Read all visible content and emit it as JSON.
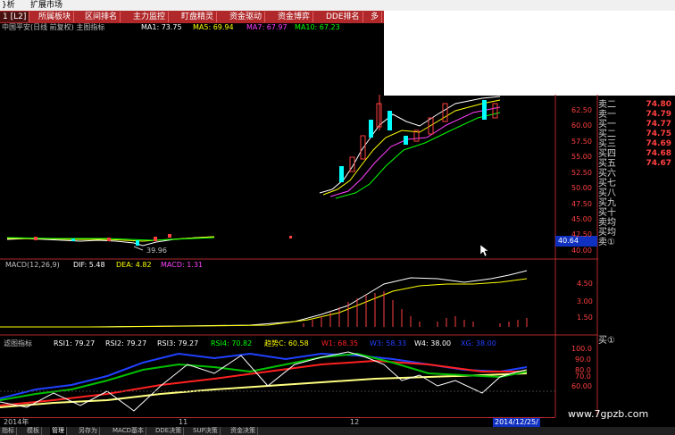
{
  "topbar": {
    "item1": "}析",
    "item2": "扩展市场"
  },
  "tabs": [
    "1 [L2]",
    "所属板块",
    "区间排名",
    "主力监控",
    "盯盘精灵",
    "资金驱动",
    "资金博弈",
    "DDE排名",
    "多"
  ],
  "info": {
    "title": "中国平安(日线 前复权) 主图指标",
    "ma1": "MA1: 73.75",
    "ma5": "MA5: 69.94",
    "ma7": "MA7: 67.97",
    "ma10": "MA10: 67.23"
  },
  "price_axis": [
    "62.50",
    "60.00",
    "57.50",
    "55.00",
    "52.50",
    "50.00",
    "47.50",
    "45.00",
    "42.50",
    "40.00"
  ],
  "price_marker": "40.64",
  "low_label": "39.96",
  "quotes": [
    {
      "label": "卖二",
      "value": "74.80"
    },
    {
      "label": "卖一",
      "value": "74.79"
    },
    {
      "label": "买一",
      "value": "74.77"
    },
    {
      "label": "买二",
      "value": "74.75"
    },
    {
      "label": "买三",
      "value": "74.69"
    },
    {
      "label": "买四",
      "value": "74.68"
    },
    {
      "label": "买五",
      "value": "74.67"
    },
    {
      "label": "买六",
      "value": ""
    },
    {
      "label": "买七",
      "value": ""
    },
    {
      "label": "买八",
      "value": ""
    },
    {
      "label": "买九",
      "value": ""
    },
    {
      "label": "买十",
      "value": ""
    },
    {
      "label": "卖均",
      "value": ""
    },
    {
      "label": "买均",
      "value": ""
    },
    {
      "label": "卖①",
      "value": ""
    }
  ],
  "macd": {
    "title": "MACD(12,26,9)",
    "dif": "DIF: 5.48",
    "dea": "DEA: 4.82",
    "macd": "MACD: 1.31",
    "axis": [
      "4.50",
      "3.00",
      "1.50"
    ]
  },
  "rsi": {
    "title": "滤图指标",
    "rsi1": "RSI1: 79.27",
    "rsi2": "RSI2: 79.27",
    "rsi3": "RSI3: 79.27",
    "rsi4": "RSI4: 70.82",
    "trend": "趋势C: 60.58",
    "w1": "W1: 68.35",
    "w3": "W3: 58.33",
    "w4": "W4: 38.00",
    "xg": "XG: 38.00",
    "axis": [
      "100.0",
      "90.0",
      "80.0",
      "70.0",
      "60.00"
    ],
    "side_label": "买①"
  },
  "dates": {
    "d1": "2014年",
    "d2": "11",
    "d3": "12",
    "d4": "2014/12/25/"
  },
  "bottom_tabs": [
    "指标",
    "模板",
    "管理",
    "另存为",
    "MACD基本",
    "DDE决策",
    "SUP决策",
    "资金决策"
  ],
  "watermark": "www.7gpzb.com",
  "colors": {
    "red": "#ff4040",
    "tab_red": "#b0282a",
    "yellow": "#ffff00",
    "magenta": "#ff40ff",
    "green": "#00ff00"
  }
}
